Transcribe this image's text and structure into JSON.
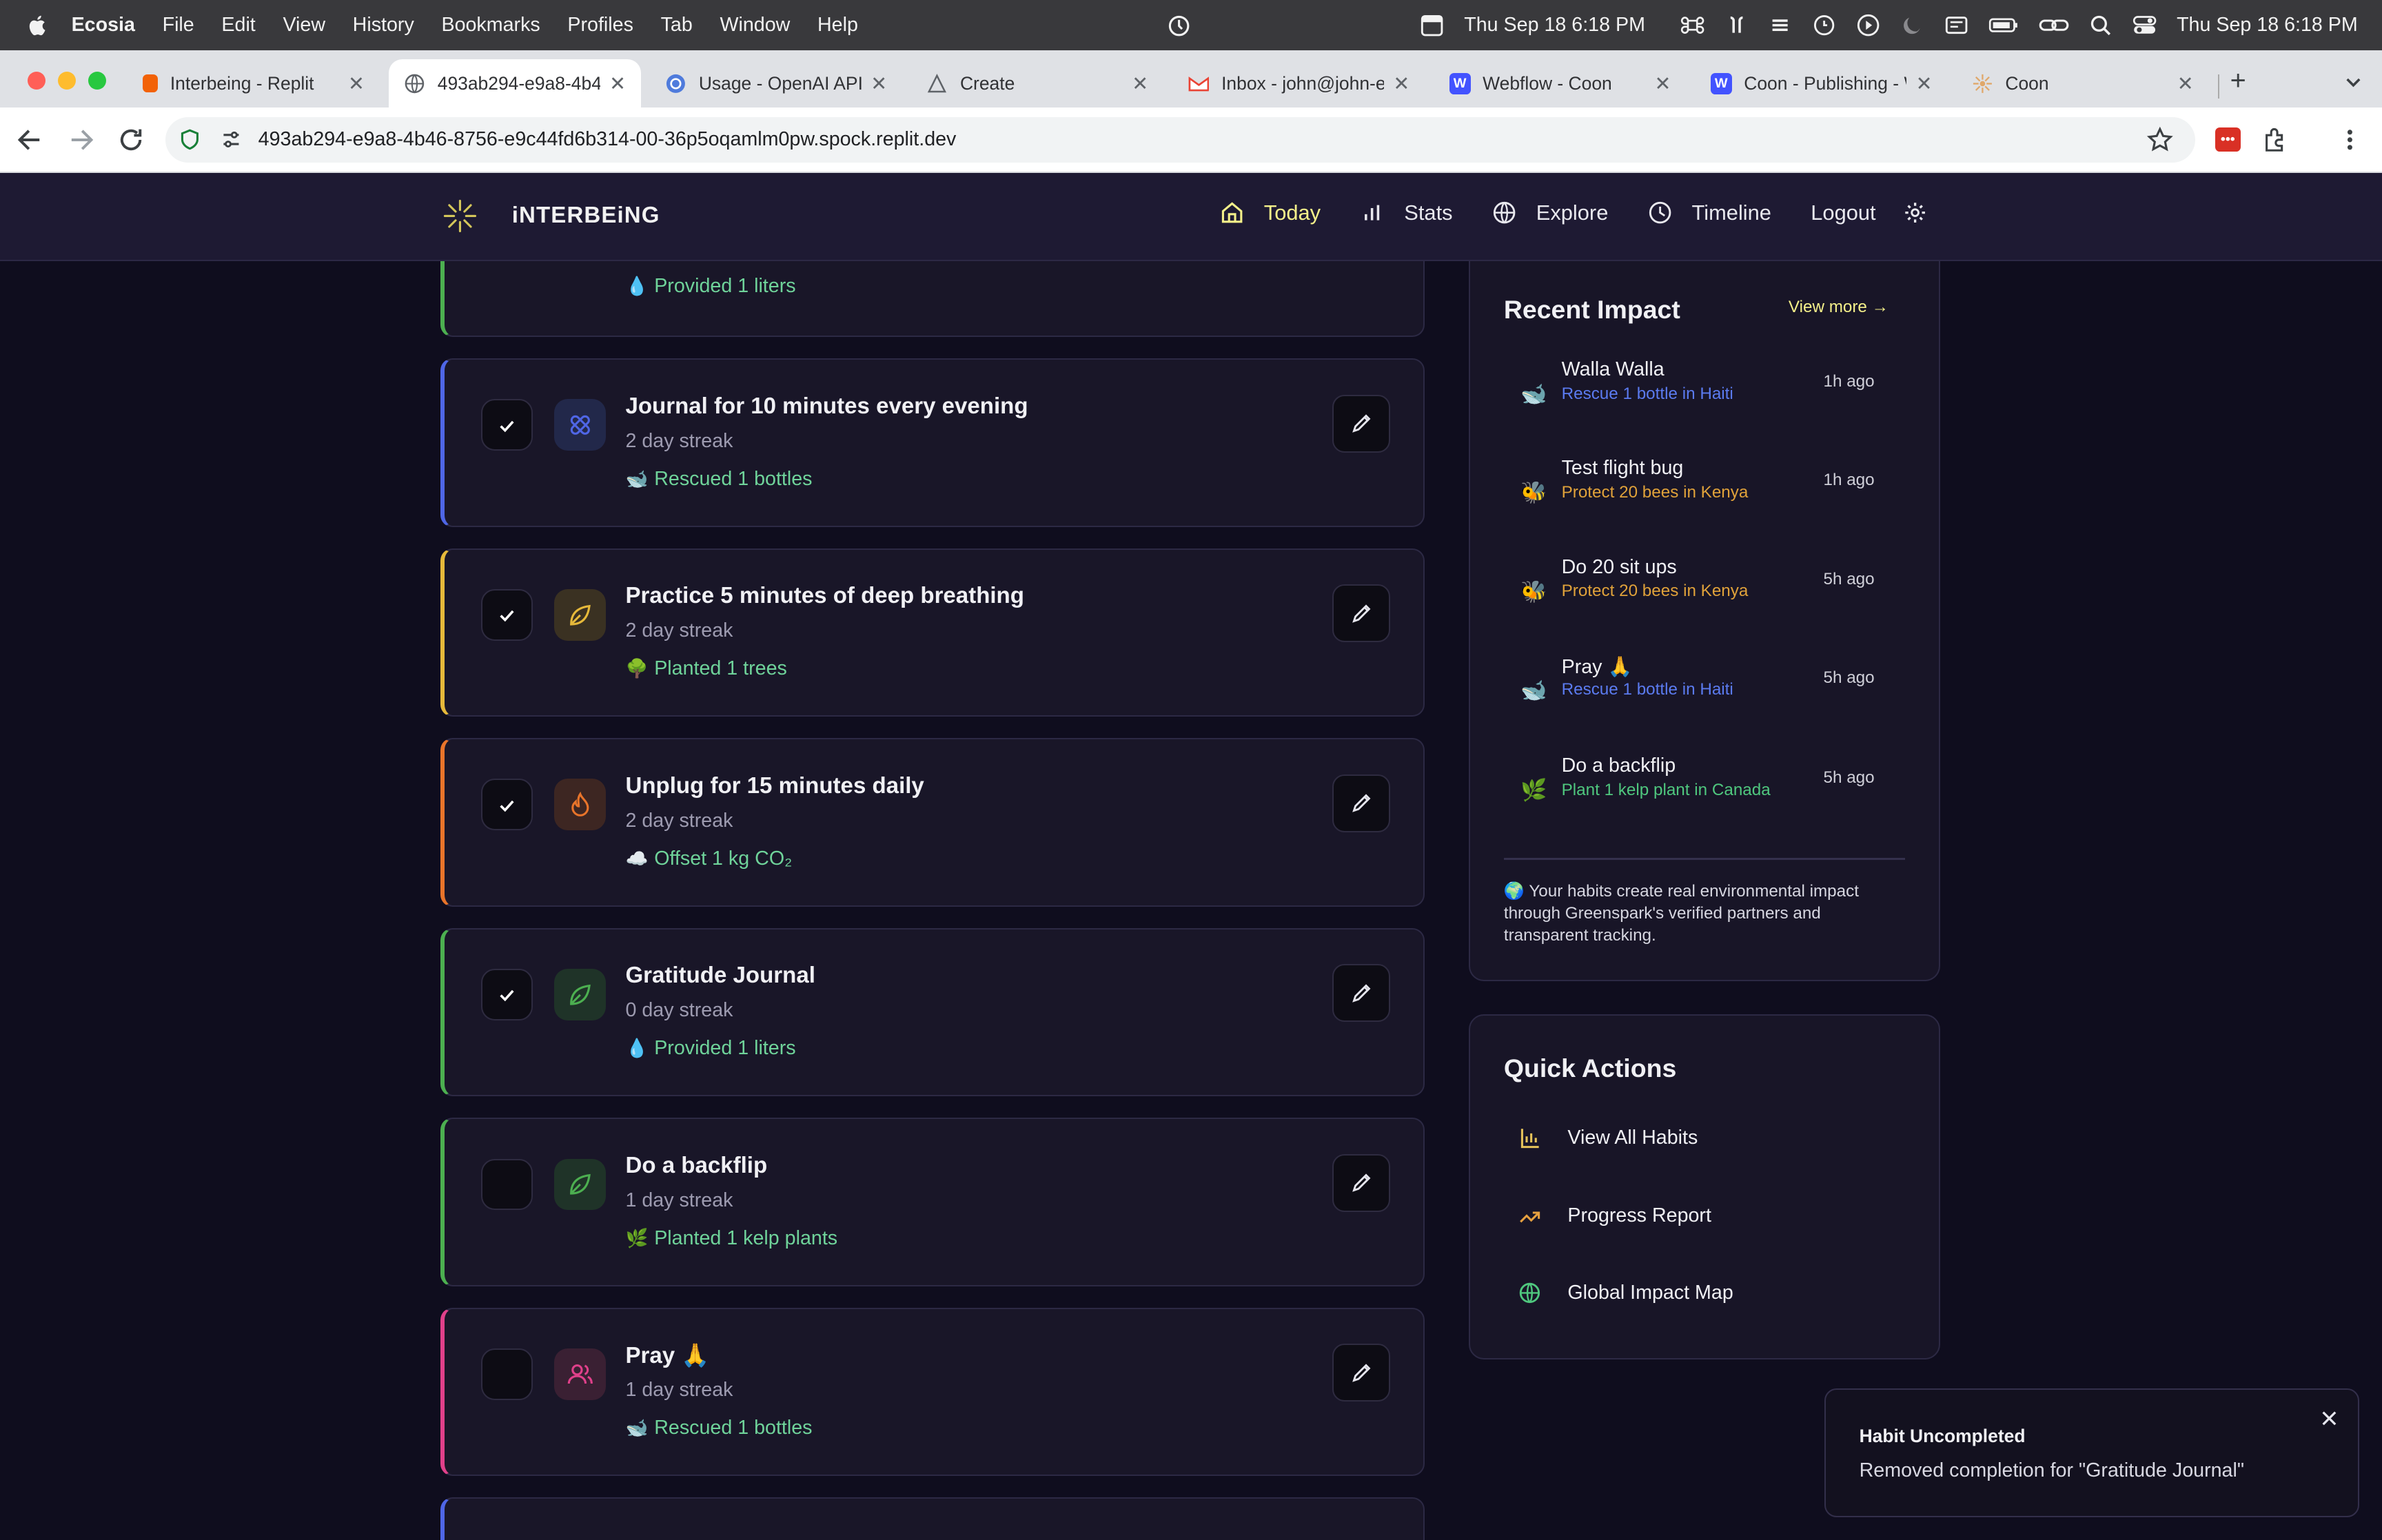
{
  "menubar": {
    "app_name": "Ecosia",
    "menus": [
      "File",
      "Edit",
      "View",
      "History",
      "Bookmarks",
      "Profiles",
      "Tab",
      "Window",
      "Help"
    ],
    "date_time_1": "Thu Sep 18  6:18 PM",
    "date_time_2": "Thu Sep 18  6:18 PM"
  },
  "tabs": [
    {
      "title": "Interbeing - Replit",
      "favicon_color": "#f26207"
    },
    {
      "title": "493ab294-e9a8-4b4",
      "favicon_color": "#5f6368"
    },
    {
      "title": "Usage - OpenAI API",
      "favicon_color": "#4f7bdc"
    },
    {
      "title": "Create",
      "favicon_color": "#5f6368"
    },
    {
      "title": "Inbox - john@john-el",
      "favicon_color": "#ea4335"
    },
    {
      "title": "Webflow - Coon",
      "favicon_color": "#4353ff"
    },
    {
      "title": "Coon - Publishing - W",
      "favicon_color": "#4353ff"
    },
    {
      "title": "Coon",
      "favicon_color": "#e0a86b"
    }
  ],
  "address_bar": {
    "url": "493ab294-e9a8-4b46-8756-e9c44fd6b314-00-36p5oqamlm0pw.spock.replit.dev"
  },
  "app": {
    "brand": "iNTERBEiNG",
    "nav": [
      {
        "label": "Today",
        "icon": "home-icon",
        "active": true
      },
      {
        "label": "Stats",
        "icon": "bar-chart-icon",
        "active": false
      },
      {
        "label": "Explore",
        "icon": "globe-icon",
        "active": false
      },
      {
        "label": "Timeline",
        "icon": "clock-icon",
        "active": false
      },
      {
        "label": "Logout",
        "icon": "",
        "active": false
      }
    ]
  },
  "habits": {
    "partial_top": {
      "impact_emoji": "💧",
      "impact": "Provided 1 liters",
      "accent": "#4caf50"
    },
    "items": [
      {
        "title": "Journal for 10 minutes every evening",
        "streak": "2 day streak",
        "impact_emoji": "🐋",
        "impact": "Rescued 1 bottles",
        "checked": true,
        "accent": "#4f66e6",
        "icon": "bandage-icon"
      },
      {
        "title": "Practice 5 minutes of deep breathing",
        "streak": "2 day streak",
        "impact_emoji": "🌳",
        "impact": "Planted 1 trees",
        "checked": true,
        "accent": "#e6b93a",
        "icon": "leaf-icon"
      },
      {
        "title": "Unplug for 15 minutes daily",
        "streak": "2 day streak",
        "impact_emoji": "☁️",
        "impact": "Offset 1 kg CO₂",
        "checked": true,
        "accent": "#e8742a",
        "icon": "flame-icon"
      },
      {
        "title": "Gratitude Journal",
        "streak": "0 day streak",
        "impact_emoji": "💧",
        "impact": "Provided 1 liters",
        "checked": true,
        "accent": "#4caf50",
        "icon": "leaf-icon"
      },
      {
        "title": "Do a backflip",
        "streak": "1 day streak",
        "impact_emoji": "🌿",
        "impact": "Planted 1 kelp plants",
        "checked": false,
        "accent": "#4caf50",
        "icon": "leaf-icon"
      },
      {
        "title": "Pray 🙏",
        "streak": "1 day streak",
        "impact_emoji": "🐋",
        "impact": "Rescued 1 bottles",
        "checked": false,
        "accent": "#e0408a",
        "icon": "users-icon"
      }
    ],
    "partial_bottom": {
      "accent": "#4f66e6"
    }
  },
  "recent_impact": {
    "title": "Recent Impact",
    "view_more": "View more →",
    "items": [
      {
        "emoji": "🐋",
        "name": "Walla Walla",
        "sub": "Rescue 1 bottle in Haiti",
        "sub_color": "#5b7bf0",
        "time": "1h ago"
      },
      {
        "emoji": "🐝",
        "name": "Test flight bug",
        "sub": "Protect 20 bees in Kenya",
        "sub_color": "#e0a23a",
        "time": "1h ago"
      },
      {
        "emoji": "🐝",
        "name": "Do 20 sit ups",
        "sub": "Protect 20 bees in Kenya",
        "sub_color": "#e0a23a",
        "time": "5h ago"
      },
      {
        "emoji": "🐋",
        "name": "Pray 🙏",
        "sub": "Rescue 1 bottle in Haiti",
        "sub_color": "#5b7bf0",
        "time": "5h ago"
      },
      {
        "emoji": "🌿",
        "name": "Do a backflip",
        "sub": "Plant 1 kelp plant in Canada",
        "sub_color": "#4fc77e",
        "time": "5h ago"
      }
    ],
    "note": "🌍 Your habits create real environmental impact through Greenspark's verified partners and transparent tracking."
  },
  "quick_actions": {
    "title": "Quick Actions",
    "items": [
      {
        "label": "View All Habits",
        "icon": "bar-chart-icon",
        "color": "#e6c35a"
      },
      {
        "label": "Progress Report",
        "icon": "trending-up-icon",
        "color": "#e6a040"
      },
      {
        "label": "Global Impact Map",
        "icon": "globe-icon",
        "color": "#4fc77e"
      }
    ]
  },
  "toast": {
    "title": "Habit Uncompleted",
    "body": "Removed completion for \"Gratitude Journal\""
  }
}
